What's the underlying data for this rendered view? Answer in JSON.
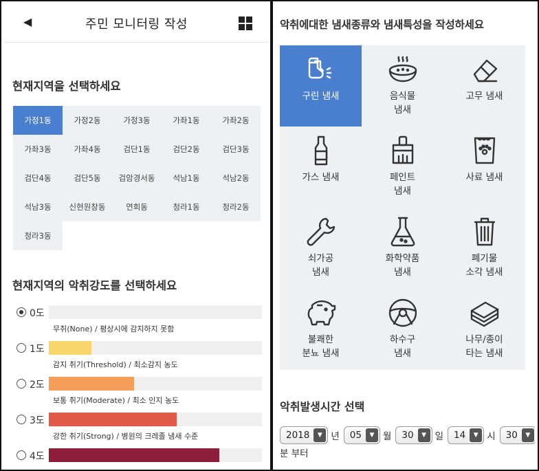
{
  "header": {
    "back_icon": "chevron-left-icon",
    "title": "주민 모니터링 작성",
    "menu_icon": "grid-icon"
  },
  "region_section": {
    "title": "현재지역을 선택하세요",
    "selected": "가정1동",
    "regions": [
      "가정1동",
      "가정2동",
      "가정3동",
      "가좌1동",
      "가좌2동",
      "가좌3동",
      "가좌4동",
      "검단1동",
      "검단2동",
      "검단3동",
      "검단4동",
      "검단5동",
      "검암경서동",
      "석남1동",
      "석남2동",
      "석남3동",
      "신현원창동",
      "연희동",
      "청라1동",
      "청라2동",
      "청라3동"
    ]
  },
  "intensity_section": {
    "title": "현재지역의 악취강도를 선택하세요",
    "selected_level": "0도",
    "levels": [
      {
        "label": "0도",
        "desc": "무취(None) / 평상시에 감지하지 못함",
        "fill_fraction": 0.0,
        "color": "#efefef"
      },
      {
        "label": "1도",
        "desc": "감지 취기(Threshold) / 최소감지 농도",
        "fill_fraction": 0.2,
        "color": "#f7d56a"
      },
      {
        "label": "2도",
        "desc": "보통 취기(Moderate) / 최소 인지 농도",
        "fill_fraction": 0.4,
        "color": "#f59e5a"
      },
      {
        "label": "3도",
        "desc": "강한 취기(Strong) / 병원의 크레졸 냄새 수준",
        "fill_fraction": 0.6,
        "color": "#e05a4a"
      },
      {
        "label": "4도",
        "desc": "",
        "fill_fraction": 0.8,
        "color": "#8e1e3a"
      }
    ]
  },
  "smell_section": {
    "title": "악취에대한 냄새종류와 냄새특성을 작성하세요",
    "selected": "구린 냄새",
    "accent_color": "#4a7fcf",
    "items": [
      {
        "label": "구린 냄새",
        "icon": "socks-icon"
      },
      {
        "label": "음식물\n냄새",
        "icon": "food-bowl-icon"
      },
      {
        "label": "고무 냄새",
        "icon": "eraser-icon"
      },
      {
        "label": "가스 냄새",
        "icon": "bottle-icon"
      },
      {
        "label": "페인트\n냄새",
        "icon": "paint-brush-icon"
      },
      {
        "label": "사료 냄새",
        "icon": "pet-food-bag-icon"
      },
      {
        "label": "쇠가공\n냄새",
        "icon": "wrench-icon"
      },
      {
        "label": "화학약품\n냄새",
        "icon": "flask-icon"
      },
      {
        "label": "폐기물\n소각 냄새",
        "icon": "trash-can-icon"
      },
      {
        "label": "불쾌한\n분뇨 냄새",
        "icon": "pig-icon"
      },
      {
        "label": "하수구\n냄새",
        "icon": "steering-wheel-icon"
      },
      {
        "label": "나무/종이\n타는 냄새",
        "icon": "book-stack-icon"
      }
    ]
  },
  "time_section": {
    "title": "악취발생시간 선택",
    "year": "2018",
    "year_unit": "년",
    "month": "05",
    "month_unit": "월",
    "day": "30",
    "day_unit": "일",
    "hour": "14",
    "hour_unit": "시",
    "minute": "30",
    "minute_unit": "분 부터"
  }
}
